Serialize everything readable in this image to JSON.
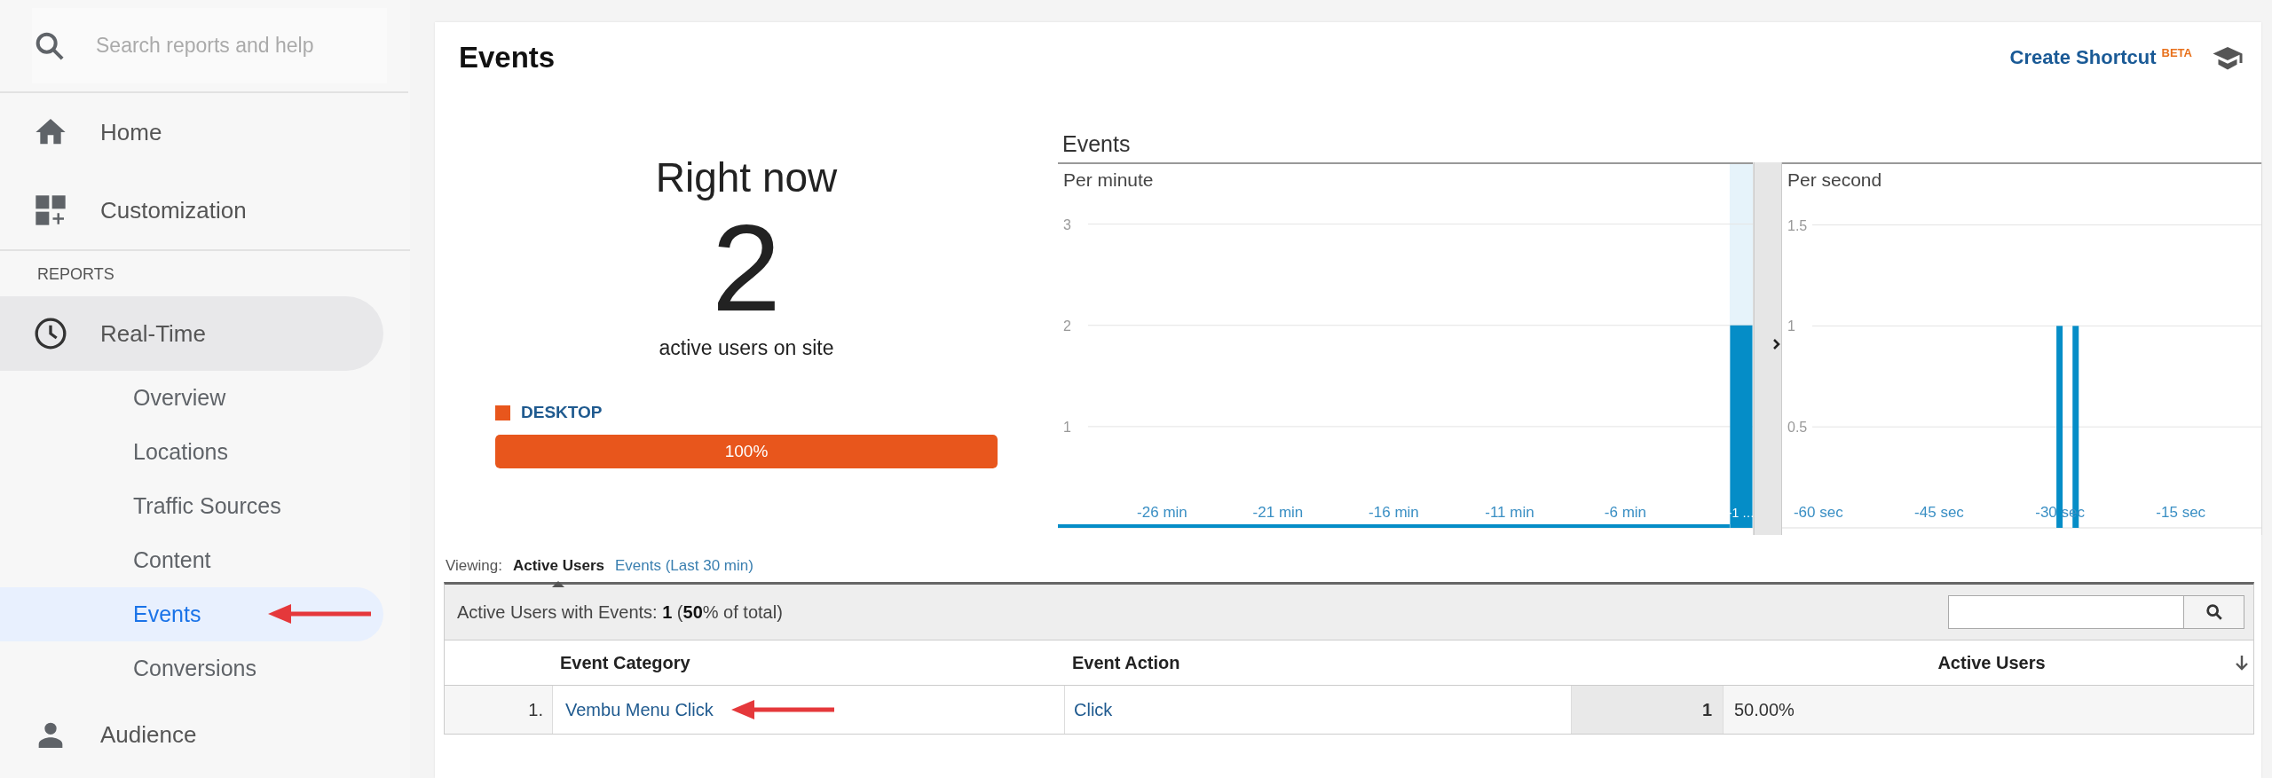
{
  "sidebar": {
    "search": {
      "placeholder": "Search reports and help"
    },
    "top_items": [
      {
        "label": "Home",
        "kind": "home"
      },
      {
        "label": "Customization",
        "kind": "dashboard"
      }
    ],
    "section_label": "REPORTS",
    "report_items": [
      {
        "label": "Real-Time",
        "kind": "clock",
        "expanded": true,
        "children": [
          {
            "label": "Overview",
            "selected": false,
            "marked": false
          },
          {
            "label": "Locations",
            "selected": false,
            "marked": false
          },
          {
            "label": "Traffic Sources",
            "selected": false,
            "marked": false
          },
          {
            "label": "Content",
            "selected": false,
            "marked": false
          },
          {
            "label": "Events",
            "selected": true,
            "marked": true
          },
          {
            "label": "Conversions",
            "selected": false,
            "marked": false
          }
        ]
      },
      {
        "label": "Audience",
        "kind": "person",
        "expanded": false
      }
    ]
  },
  "page_title": "Events",
  "shortcut": {
    "label": "Create Shortcut",
    "badge": "BETA"
  },
  "right_now": {
    "heading": "Right now",
    "count": "2",
    "caption": "active users on site",
    "devices": [
      {
        "label": "DESKTOP",
        "color": "#e8561c",
        "level": 1,
        "reading": "100%"
      }
    ]
  },
  "events_chart": {
    "title": "Events",
    "panels": [
      {
        "label": "Per minute",
        "highlight_last": true,
        "chart_data": {
          "type": "bar",
          "x": [
            -30,
            -29,
            -28,
            -27,
            -26,
            -25,
            -24,
            -23,
            -22,
            -21,
            -20,
            -19,
            -18,
            -17,
            -16,
            -15,
            -14,
            -13,
            -12,
            -11,
            -10,
            -9,
            -8,
            -7,
            -6,
            -5,
            -4,
            -3,
            -2,
            -1
          ],
          "series": [
            {
              "color": "#058dc7",
              "values": [
                0,
                0,
                0,
                0,
                0,
                0,
                0,
                0,
                0,
                0,
                0,
                0,
                0,
                0,
                0,
                0,
                0,
                0,
                0,
                0,
                0,
                0,
                0,
                0,
                0,
                0,
                0,
                0,
                0,
                2
              ]
            }
          ],
          "xlim": [
            -30.5,
            -0.5
          ],
          "ylim": [
            0,
            3.61
          ],
          "grid": true,
          "yticks": [
            1,
            2,
            3
          ],
          "xticks": [
            {
              "value": -26,
              "label": "-26 min"
            },
            {
              "value": -21,
              "label": "-21 min"
            },
            {
              "value": -16,
              "label": "-16 min"
            },
            {
              "value": -11,
              "label": "-11 min"
            },
            {
              "value": -6,
              "label": "-6 min"
            },
            {
              "value": -1,
              "label": "-1 …"
            }
          ]
        }
      },
      {
        "label": "Per second",
        "highlight_last": false,
        "chart_data": {
          "type": "bar",
          "x": [
            -30,
            -28
          ],
          "series": [
            {
              "color": "#058dc7",
              "values": [
                1,
                1
              ]
            }
          ],
          "xlim": [
            -64.5,
            -5
          ],
          "ylim": [
            0,
            1.81
          ],
          "grid": true,
          "yticks": [
            0.5,
            1,
            1.5
          ],
          "xticks": [
            {
              "value": -60,
              "label": "-60 sec"
            },
            {
              "value": -45,
              "label": "-45 sec"
            },
            {
              "value": -30,
              "label": "-30 sec"
            },
            {
              "value": -15,
              "label": "-15 sec"
            }
          ]
        }
      }
    ]
  },
  "table": {
    "viewing_label": "Viewing:",
    "views": [
      {
        "label": "Active Users",
        "selected": true
      },
      {
        "label": "Events (Last 30 min)",
        "selected": false
      }
    ],
    "summary": "Active Users with Events: **1** (**50**% of total)",
    "columns": [
      "Event Category",
      "Event Action",
      "Active Users"
    ],
    "rows": [
      {
        "index": "1.",
        "category": "Vembu Menu Click",
        "action": "Click",
        "users": "1",
        "share": "50.00%",
        "marked": true
      }
    ]
  }
}
